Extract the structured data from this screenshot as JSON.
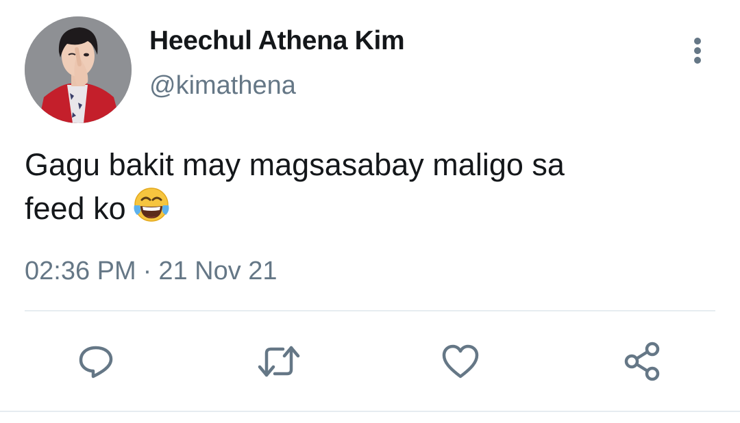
{
  "tweet": {
    "display_name": "Heechul Athena Kim",
    "handle": "@kimathena",
    "text_line1": "Gagu bakit may magsasabay maligo sa",
    "text_line2": "feed ko",
    "emoji": "face-with-tears-of-joy",
    "time": "02:36 PM",
    "separator": "·",
    "date": "21 Nov 21"
  },
  "actions": {
    "reply_icon": "reply-icon",
    "retweet_icon": "retweet-icon",
    "like_icon": "heart-icon",
    "share_icon": "share-icon",
    "more_icon": "more-vertical-icon"
  },
  "colors": {
    "text": "#14171a",
    "secondary": "#657786",
    "icon": "#657786",
    "divider": "#e6ecf0",
    "avatar_jacket": "#c4202a"
  }
}
